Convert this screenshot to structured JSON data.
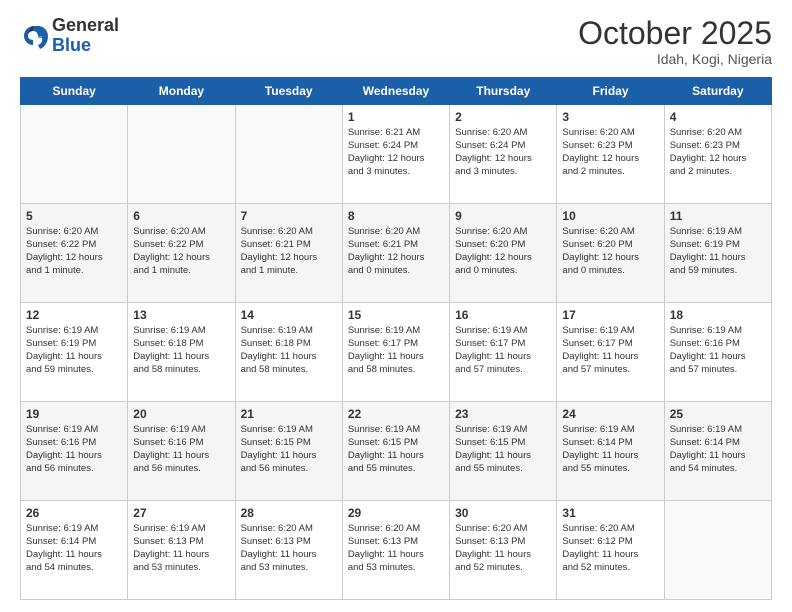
{
  "header": {
    "logo": {
      "general": "General",
      "blue": "Blue"
    },
    "title": "October 2025",
    "location": "Idah, Kogi, Nigeria"
  },
  "weekdays": [
    "Sunday",
    "Monday",
    "Tuesday",
    "Wednesday",
    "Thursday",
    "Friday",
    "Saturday"
  ],
  "weeks": [
    [
      {
        "day": "",
        "info": ""
      },
      {
        "day": "",
        "info": ""
      },
      {
        "day": "",
        "info": ""
      },
      {
        "day": "1",
        "info": "Sunrise: 6:21 AM\nSunset: 6:24 PM\nDaylight: 12 hours\nand 3 minutes."
      },
      {
        "day": "2",
        "info": "Sunrise: 6:20 AM\nSunset: 6:24 PM\nDaylight: 12 hours\nand 3 minutes."
      },
      {
        "day": "3",
        "info": "Sunrise: 6:20 AM\nSunset: 6:23 PM\nDaylight: 12 hours\nand 2 minutes."
      },
      {
        "day": "4",
        "info": "Sunrise: 6:20 AM\nSunset: 6:23 PM\nDaylight: 12 hours\nand 2 minutes."
      }
    ],
    [
      {
        "day": "5",
        "info": "Sunrise: 6:20 AM\nSunset: 6:22 PM\nDaylight: 12 hours\nand 1 minute."
      },
      {
        "day": "6",
        "info": "Sunrise: 6:20 AM\nSunset: 6:22 PM\nDaylight: 12 hours\nand 1 minute."
      },
      {
        "day": "7",
        "info": "Sunrise: 6:20 AM\nSunset: 6:21 PM\nDaylight: 12 hours\nand 1 minute."
      },
      {
        "day": "8",
        "info": "Sunrise: 6:20 AM\nSunset: 6:21 PM\nDaylight: 12 hours\nand 0 minutes."
      },
      {
        "day": "9",
        "info": "Sunrise: 6:20 AM\nSunset: 6:20 PM\nDaylight: 12 hours\nand 0 minutes."
      },
      {
        "day": "10",
        "info": "Sunrise: 6:20 AM\nSunset: 6:20 PM\nDaylight: 12 hours\nand 0 minutes."
      },
      {
        "day": "11",
        "info": "Sunrise: 6:19 AM\nSunset: 6:19 PM\nDaylight: 11 hours\nand 59 minutes."
      }
    ],
    [
      {
        "day": "12",
        "info": "Sunrise: 6:19 AM\nSunset: 6:19 PM\nDaylight: 11 hours\nand 59 minutes."
      },
      {
        "day": "13",
        "info": "Sunrise: 6:19 AM\nSunset: 6:18 PM\nDaylight: 11 hours\nand 58 minutes."
      },
      {
        "day": "14",
        "info": "Sunrise: 6:19 AM\nSunset: 6:18 PM\nDaylight: 11 hours\nand 58 minutes."
      },
      {
        "day": "15",
        "info": "Sunrise: 6:19 AM\nSunset: 6:17 PM\nDaylight: 11 hours\nand 58 minutes."
      },
      {
        "day": "16",
        "info": "Sunrise: 6:19 AM\nSunset: 6:17 PM\nDaylight: 11 hours\nand 57 minutes."
      },
      {
        "day": "17",
        "info": "Sunrise: 6:19 AM\nSunset: 6:17 PM\nDaylight: 11 hours\nand 57 minutes."
      },
      {
        "day": "18",
        "info": "Sunrise: 6:19 AM\nSunset: 6:16 PM\nDaylight: 11 hours\nand 57 minutes."
      }
    ],
    [
      {
        "day": "19",
        "info": "Sunrise: 6:19 AM\nSunset: 6:16 PM\nDaylight: 11 hours\nand 56 minutes."
      },
      {
        "day": "20",
        "info": "Sunrise: 6:19 AM\nSunset: 6:16 PM\nDaylight: 11 hours\nand 56 minutes."
      },
      {
        "day": "21",
        "info": "Sunrise: 6:19 AM\nSunset: 6:15 PM\nDaylight: 11 hours\nand 56 minutes."
      },
      {
        "day": "22",
        "info": "Sunrise: 6:19 AM\nSunset: 6:15 PM\nDaylight: 11 hours\nand 55 minutes."
      },
      {
        "day": "23",
        "info": "Sunrise: 6:19 AM\nSunset: 6:15 PM\nDaylight: 11 hours\nand 55 minutes."
      },
      {
        "day": "24",
        "info": "Sunrise: 6:19 AM\nSunset: 6:14 PM\nDaylight: 11 hours\nand 55 minutes."
      },
      {
        "day": "25",
        "info": "Sunrise: 6:19 AM\nSunset: 6:14 PM\nDaylight: 11 hours\nand 54 minutes."
      }
    ],
    [
      {
        "day": "26",
        "info": "Sunrise: 6:19 AM\nSunset: 6:14 PM\nDaylight: 11 hours\nand 54 minutes."
      },
      {
        "day": "27",
        "info": "Sunrise: 6:19 AM\nSunset: 6:13 PM\nDaylight: 11 hours\nand 53 minutes."
      },
      {
        "day": "28",
        "info": "Sunrise: 6:20 AM\nSunset: 6:13 PM\nDaylight: 11 hours\nand 53 minutes."
      },
      {
        "day": "29",
        "info": "Sunrise: 6:20 AM\nSunset: 6:13 PM\nDaylight: 11 hours\nand 53 minutes."
      },
      {
        "day": "30",
        "info": "Sunrise: 6:20 AM\nSunset: 6:13 PM\nDaylight: 11 hours\nand 52 minutes."
      },
      {
        "day": "31",
        "info": "Sunrise: 6:20 AM\nSunset: 6:12 PM\nDaylight: 11 hours\nand 52 minutes."
      },
      {
        "day": "",
        "info": ""
      }
    ]
  ]
}
